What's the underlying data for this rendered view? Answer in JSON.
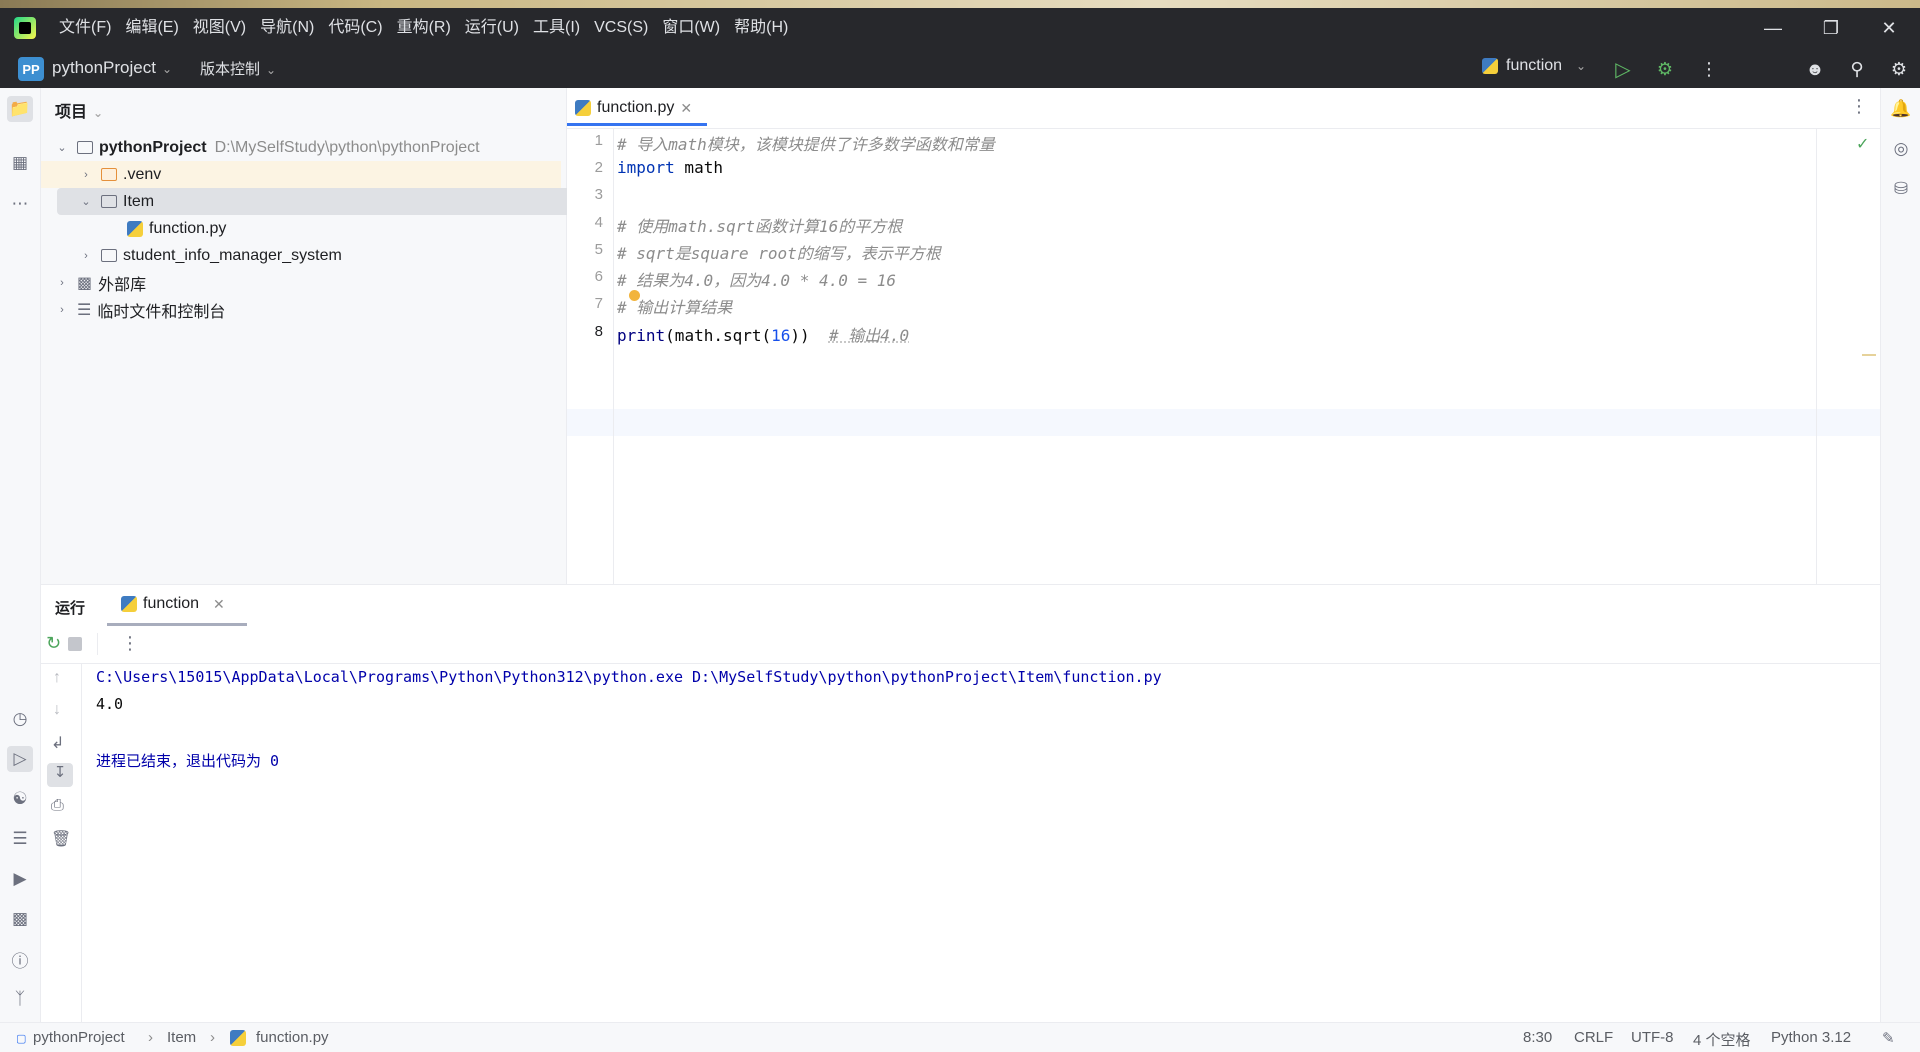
{
  "menu": [
    "文件(F)",
    "编辑(E)",
    "视图(V)",
    "导航(N)",
    "代码(C)",
    "重构(R)",
    "运行(U)",
    "工具(I)",
    "VCS(S)",
    "窗口(W)",
    "帮助(H)"
  ],
  "toolbar": {
    "project_badge": "PP",
    "project_name": "pythonProject",
    "vcs_label": "版本控制",
    "run_config": "function"
  },
  "project_panel": {
    "title": "项目",
    "root_name": "pythonProject",
    "root_path": "D:\\MySelfStudy\\python\\pythonProject",
    "venv": ".venv",
    "item_folder": "Item",
    "file": "function.py",
    "other_folder": "student_info_manager_system",
    "external_libs": "外部库",
    "scratches": "临时文件和控制台"
  },
  "editor": {
    "tab_label": "function.py",
    "line_numbers": [
      "1",
      "2",
      "3",
      "4",
      "5",
      "6",
      "7",
      "8"
    ],
    "lines": {
      "l1": "# 导入math模块，该模块提供了许多数学函数和常量",
      "l2_kw": "import",
      "l2_rest": " math",
      "l4": "# 使用math.sqrt函数计算16的平方根",
      "l5": "# sqrt是square root的缩写，表示平方根",
      "l6": "# 结果为4.0，因为4.0 * 4.0 = 16",
      "l7": "# 输出计算结果",
      "l8_fn": "print",
      "l8_a": "(math.sqrt(",
      "l8_num": "16",
      "l8_b": "))  ",
      "l8_cm": "# 输出4.0"
    }
  },
  "run_panel": {
    "title": "运行",
    "tab_label": "function",
    "console": {
      "command": "C:\\Users\\15015\\AppData\\Local\\Programs\\Python\\Python312\\python.exe D:\\MySelfStudy\\python\\pythonProject\\Item\\function.py",
      "output": "4.0",
      "exit": "进程已结束，退出代码为 0"
    }
  },
  "statusbar": {
    "crumb_project": "pythonProject",
    "crumb_folder": "Item",
    "crumb_file": "function.py",
    "position": "8:30",
    "line_sep": "CRLF",
    "encoding": "UTF-8",
    "indent": "4 个空格",
    "interpreter": "Python 3.12"
  }
}
